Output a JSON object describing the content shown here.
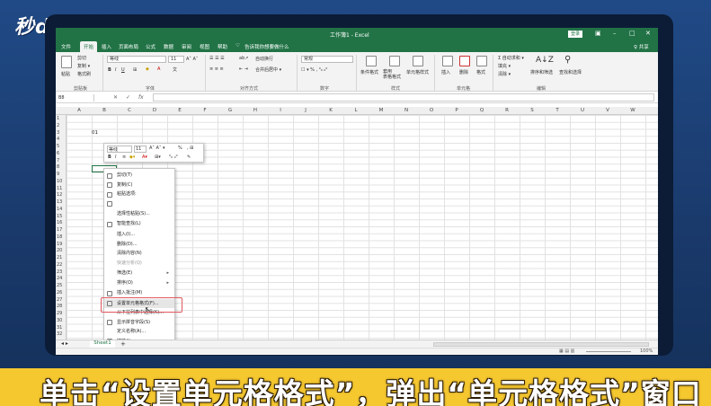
{
  "logo": {
    "text": "秒dong视频"
  },
  "window": {
    "title": "工作簿1 - Excel",
    "login": "登录",
    "share": "♀ 共享"
  },
  "tabs": [
    "文件",
    "开始",
    "插入",
    "页面布局",
    "公式",
    "数据",
    "审阅",
    "视图",
    "帮助",
    "♡",
    "告诉我你想要做什么"
  ],
  "ribbon": {
    "paste": "粘贴",
    "cut": "剪切",
    "copy": "复制 ▾",
    "format_painter": "格式刷",
    "clipboard": "剪贴板",
    "font_name": "等线",
    "font_size": "11",
    "font": "字体",
    "wrap": "自动换行",
    "merge": "合并后居中 ▾",
    "alignment": "对齐方式",
    "number_format": "常规",
    "number": "数字",
    "cond_format": "条件格式",
    "table_format": "套用\n表格格式",
    "cell_style": "单元格样式",
    "styles": "样式",
    "insert": "插入",
    "delete": "删除",
    "format": "格式",
    "cells": "单元格",
    "autosum": "Σ 自动求和 ▾",
    "fill": "填充 ▾",
    "clear": "清除 ▾",
    "sort": "排序和筛选",
    "find": "查找和选择",
    "editing": "编辑"
  },
  "formula": {
    "namebox": "B8",
    "fx": "fx",
    "cancel": "✕",
    "enter": "✓"
  },
  "columns": [
    "A",
    "B",
    "C",
    "D",
    "E",
    "F",
    "G",
    "H",
    "I",
    "J",
    "K",
    "L",
    "M",
    "N",
    "O",
    "P",
    "Q",
    "R",
    "S",
    "T",
    "U",
    "V",
    "W"
  ],
  "rows": [
    "1",
    "2",
    "3",
    "4",
    "5",
    "6",
    "7",
    "8",
    "9",
    "10",
    "11",
    "12",
    "13",
    "14",
    "15",
    "16",
    "17",
    "18",
    "19",
    "20",
    "21",
    "22",
    "23",
    "24",
    "25",
    "26",
    "27",
    "28",
    "29",
    "30",
    "31",
    "32"
  ],
  "cell": {
    "value": "01"
  },
  "mini_toolbar": {
    "font": "等线",
    "size": "11",
    "percent": "%"
  },
  "menu": [
    {
      "label": "剪切(T)",
      "dis": false
    },
    {
      "label": "复制(C)",
      "dis": false
    },
    {
      "label": "粘贴选项:",
      "dis": false
    },
    {
      "label": "",
      "dis": false
    },
    {
      "label": "选择性粘贴(S)...",
      "dis": false
    },
    {
      "label": "智能查找(L)",
      "dis": false
    },
    {
      "label": "插入(I)...",
      "dis": false
    },
    {
      "label": "删除(D)...",
      "dis": false
    },
    {
      "label": "清除内容(N)",
      "dis": false
    },
    {
      "label": "快速分析(Q)",
      "dis": true
    },
    {
      "label": "筛选(E)",
      "dis": false
    },
    {
      "label": "排序(O)",
      "dis": false
    },
    {
      "label": "插入批注(M)",
      "dis": false
    },
    {
      "label": "设置单元格格式(F)...",
      "dis": false
    },
    {
      "label": "从下拉列表中选择(K)...",
      "dis": false
    },
    {
      "label": "显示拼音字段(S)",
      "dis": false
    },
    {
      "label": "定义名称(A)...",
      "dis": false
    },
    {
      "label": "链接(I)",
      "dis": false
    }
  ],
  "sheet": {
    "tab": "Sheet1",
    "add": "+",
    "zoom": "100%"
  },
  "caption": "单击“设置单元格格式”，弹出“单元格格式”窗口",
  "colors": {
    "excel_green": "#217346",
    "caption_bg": "#f6c830",
    "highlight": "#e0585e"
  }
}
